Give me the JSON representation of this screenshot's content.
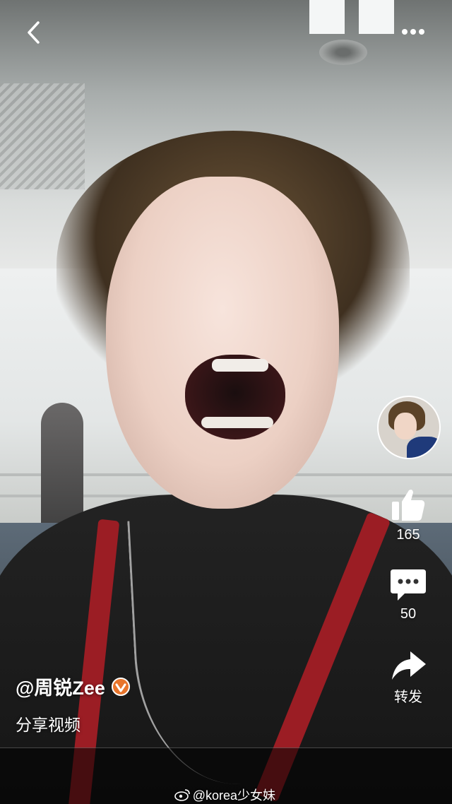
{
  "nav": {
    "back_icon": "chevron-left-icon",
    "more_icon": "more-dots-icon"
  },
  "actions": {
    "like": {
      "icon": "thumbs-up-icon",
      "count": "165"
    },
    "comment": {
      "icon": "comment-bubble-icon",
      "count": "50"
    },
    "share": {
      "icon": "share-arrow-icon",
      "label": "转发"
    }
  },
  "caption": {
    "username": "@周锐Zee",
    "verified_icon": "verified-badge-icon",
    "verified_color": "#e8742b",
    "description": "分享视频"
  },
  "watermark": {
    "icon": "weibo-icon",
    "text": "@korea少女妹"
  }
}
